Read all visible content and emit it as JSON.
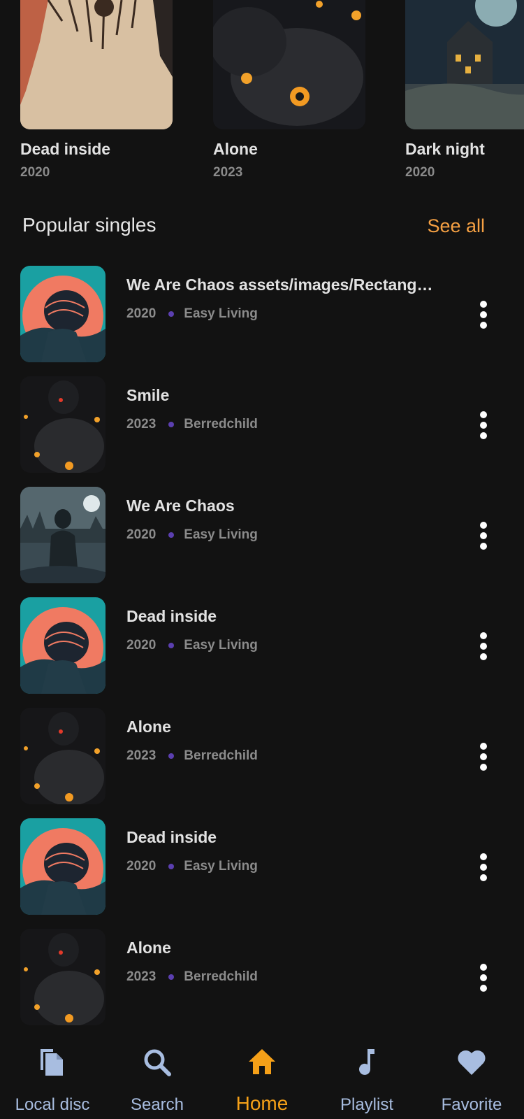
{
  "albums": [
    {
      "title": "Dead inside",
      "year": "2020"
    },
    {
      "title": "Alone",
      "year": "2023"
    },
    {
      "title": "Dark night",
      "year": "2020"
    }
  ],
  "section": {
    "title": "Popular singles",
    "see_all": "See all"
  },
  "singles": [
    {
      "title": "We Are Chaos assets/images/Rectangle...",
      "year": "2020",
      "artist": "Easy Living",
      "art": "orange-sun"
    },
    {
      "title": "Smile",
      "year": "2023",
      "artist": "Berredchild",
      "art": "dark-crows"
    },
    {
      "title": "We Are Chaos",
      "year": "2020",
      "artist": "Easy Living",
      "art": "misty-hunter"
    },
    {
      "title": "Dead inside",
      "year": "2020",
      "artist": "Easy Living",
      "art": "orange-sun"
    },
    {
      "title": "Alone",
      "year": "2023",
      "artist": "Berredchild",
      "art": "dark-crows"
    },
    {
      "title": "Dead inside",
      "year": "2020",
      "artist": "Easy Living",
      "art": "orange-sun"
    },
    {
      "title": "Alone",
      "year": "2023",
      "artist": "Berredchild",
      "art": "dark-crows"
    }
  ],
  "nav": [
    {
      "label": "Local disc",
      "icon": "file-copy-icon",
      "active": false
    },
    {
      "label": "Search",
      "icon": "search-icon",
      "active": false
    },
    {
      "label": "Home",
      "icon": "home-icon",
      "active": true
    },
    {
      "label": "Playlist",
      "icon": "music-note-icon",
      "active": false
    },
    {
      "label": "Favorite",
      "icon": "heart-icon",
      "active": false
    }
  ],
  "colors": {
    "background": "#121212",
    "accent": "#f5a043",
    "nav_active": "#f5a018",
    "nav_inactive": "#a8bde0",
    "dot": "#5b3fb0"
  }
}
